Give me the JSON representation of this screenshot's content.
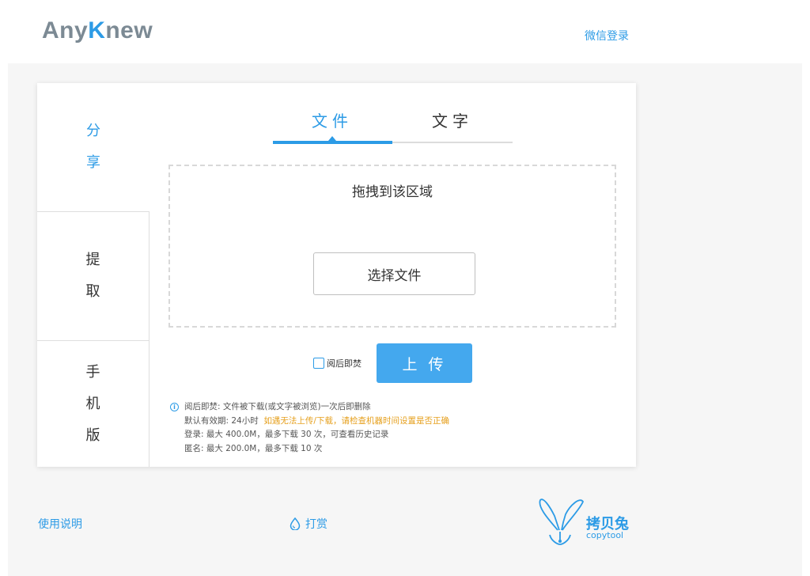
{
  "header": {
    "logo_part1": "Any",
    "logo_part2": "K",
    "logo_part3": "new",
    "login_label": "微信登录"
  },
  "sidebar": {
    "items": [
      {
        "label": "分享",
        "chars": [
          "分",
          "享"
        ]
      },
      {
        "label": "提取",
        "chars": [
          "提",
          "取"
        ]
      },
      {
        "label": "手机版",
        "chars": [
          "手",
          "机",
          "版"
        ]
      }
    ]
  },
  "tabs": [
    {
      "label": "文件"
    },
    {
      "label": "文字"
    }
  ],
  "dropzone": {
    "hint": "拖拽到该区域",
    "choose_label": "选择文件"
  },
  "upload": {
    "burn_label": "阅后即焚",
    "button_label": "上 传"
  },
  "info": {
    "line1": "阅后即焚: 文件被下载(或文字被浏览)一次后即删除",
    "line2_prefix": "默认有效期: 24小时",
    "line2_warning": "如遇无法上传/下载，请检查机器时间设置是否正确",
    "line3": "登录: 最大 400.0M，最多下载 30 次，可查看历史记录",
    "line4": "匿名: 最大 200.0M，最多下载 10 次"
  },
  "footer": {
    "help_label": "使用说明",
    "tip_label": "打赏",
    "brand_name": "拷贝兔",
    "brand_sub": "copytool"
  },
  "colors": {
    "accent": "#2c9be6",
    "warning": "#e6a01e"
  }
}
